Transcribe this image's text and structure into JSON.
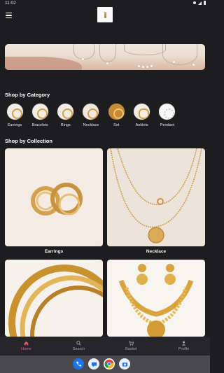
{
  "status_bar": {
    "time": "11:02"
  },
  "app": {
    "logo_icon": "brand-logo-icon",
    "menu_icon": "hamburger-menu-icon"
  },
  "sections": {
    "category_title": "Shop by Category",
    "collection_title": "Shop by Collection"
  },
  "categories": [
    {
      "label": "Earrings"
    },
    {
      "label": "Bracelets"
    },
    {
      "label": "Rings"
    },
    {
      "label": "Necklace"
    },
    {
      "label": "Set"
    },
    {
      "label": "Anklets"
    },
    {
      "label": "Pendant"
    }
  ],
  "collections": [
    {
      "label": "Earrings"
    },
    {
      "label": "Necklace"
    },
    {
      "label": ""
    },
    {
      "label": ""
    }
  ],
  "bottom_nav": [
    {
      "label": "Home",
      "icon": "home-icon",
      "active": true
    },
    {
      "label": "Search",
      "icon": "search-icon",
      "active": false
    },
    {
      "label": "Basket",
      "icon": "cart-icon",
      "active": false
    },
    {
      "label": "Profile",
      "icon": "person-icon",
      "active": false
    }
  ],
  "dock_apps": [
    "phone-app-icon",
    "messages-app-icon",
    "chrome-app-icon",
    "camera-app-icon"
  ],
  "colors": {
    "background": "#1d1d1f",
    "accent": "#e85e73",
    "gold": "#d1a24b"
  }
}
